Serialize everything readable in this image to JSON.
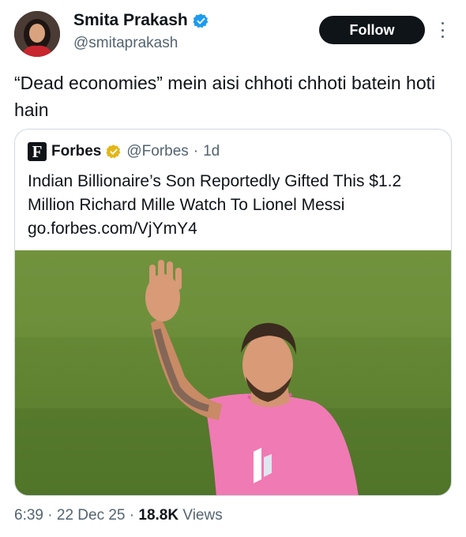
{
  "author": {
    "name": "Smita Prakash",
    "handle": "@smitaprakash",
    "verified_color": "#1d9bf0"
  },
  "follow_label": "Follow",
  "tweet_text": "“Dead economies” mein aisi chhoti chhoti batein hoti hain",
  "quote": {
    "logo_letter": "F",
    "name": "Forbes",
    "verified_color": "#e2b719",
    "handle": "@Forbes",
    "separator": "·",
    "time": "1d",
    "text": "Indian Billionaire’s Son Reportedly Gifted This $1.2 Million Richard Mille Watch To Lionel Messi go.forbes.com/VjYmY4"
  },
  "footer": {
    "time": "6:39",
    "sep1": "·",
    "date": "22 Dec 25",
    "sep2": "·",
    "views_count": "18.8K",
    "views_label": "Views"
  }
}
